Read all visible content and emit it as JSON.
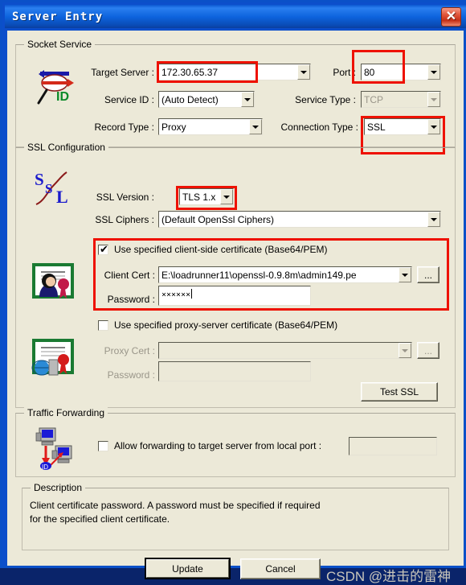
{
  "window": {
    "title": "Server Entry",
    "close_label": "✕",
    "accent_blue": "#0c4ecb",
    "face": "#ece9d8",
    "highlight_red": "#ee1100"
  },
  "socket_service": {
    "legend": "Socket Service",
    "icon": "id-magnifier-icon",
    "target_server_label": "Target Server :",
    "target_server_value": "172.30.65.37",
    "port_label": "Port :",
    "port_value": "80",
    "service_id_label": "Service ID :",
    "service_id_value": "(Auto Detect)",
    "service_type_label": "Service Type :",
    "service_type_value": "TCP",
    "record_type_label": "Record Type :",
    "record_type_value": "Proxy",
    "connection_type_label": "Connection Type :",
    "connection_type_value": "SSL"
  },
  "ssl_configuration": {
    "legend": "SSL Configuration",
    "icon": "ssl-icon",
    "ssl_version_label": "SSL Version :",
    "ssl_version_value": "TLS 1.x",
    "ssl_ciphers_label": "SSL Ciphers :",
    "ssl_ciphers_value": "(Default OpenSsl Ciphers)",
    "client_cert_checkbox_label": "Use specified client-side certificate (Base64/PEM)",
    "client_cert_checked": true,
    "client_cert_tick": "✔",
    "client_cert_icon": "client-certificate-icon",
    "client_cert_label": "Client Cert :",
    "client_cert_value": "E:\\loadrunner11\\openssl-0.9.8m\\admin149.pe",
    "client_cert_browse_label": "...",
    "client_password_label": "Password :",
    "client_password_value": "××××××",
    "proxy_cert_checkbox_label": "Use specified proxy-server certificate (Base64/PEM)",
    "proxy_cert_checked": false,
    "proxy_cert_icon": "proxy-certificate-icon",
    "proxy_cert_label": "Proxy Cert :",
    "proxy_cert_value": "",
    "proxy_cert_browse_label": "...",
    "proxy_password_label": "Password :",
    "proxy_password_value": "",
    "test_ssl_label": "Test SSL"
  },
  "traffic_forwarding": {
    "legend": "Traffic Forwarding",
    "icon": "forwarding-icon",
    "allow_forwarding_label": "Allow forwarding to target server from local port :",
    "allow_forwarding_checked": false,
    "local_port_value": ""
  },
  "description": {
    "legend": "Description",
    "line1": "Client certificate password.  A password must be specified if required",
    "line2": "for the specified client certificate."
  },
  "footer": {
    "update_label": "Update",
    "cancel_label": "Cancel",
    "watermark": "CSDN @进击的雷神"
  }
}
